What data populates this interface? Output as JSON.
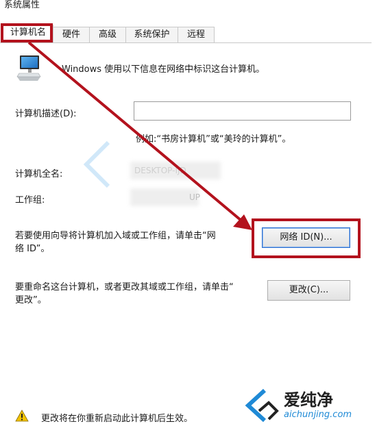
{
  "window": {
    "title": "系统属性"
  },
  "tabs": [
    {
      "label": "计算机名",
      "active": true
    },
    {
      "label": "硬件",
      "active": false
    },
    {
      "label": "高级",
      "active": false
    },
    {
      "label": "系统保护",
      "active": false
    },
    {
      "label": "远程",
      "active": false
    }
  ],
  "intro": {
    "text": "Windows 使用以下信息在网络中标识这台计算机。"
  },
  "description": {
    "label": "计算机描述(D):",
    "value": "",
    "example": "例如:“书房计算机”或“美玲的计算机”。"
  },
  "full_name": {
    "label": "计算机全名:",
    "value": "DESKTOP-IJD"
  },
  "workgroup": {
    "label": "工作组:",
    "value": "UP"
  },
  "network": {
    "line1": "若要使用向导将计算机加入域或工作组，请单击“网",
    "line2": "络 ID”。",
    "button": "网络 ID(N)..."
  },
  "rename": {
    "line1": "要重命名这台计算机，或者更改其域或工作组，请单击“",
    "line2": "更改”。",
    "button": "更改(C)..."
  },
  "warning": {
    "text": "更改将在你重新启动此计算机后生效。"
  },
  "watermark": {
    "brand": "爱纯净",
    "url": "aichunjing.com"
  },
  "colors": {
    "highlight": "#b3121d",
    "accent": "#2b6fd1"
  }
}
